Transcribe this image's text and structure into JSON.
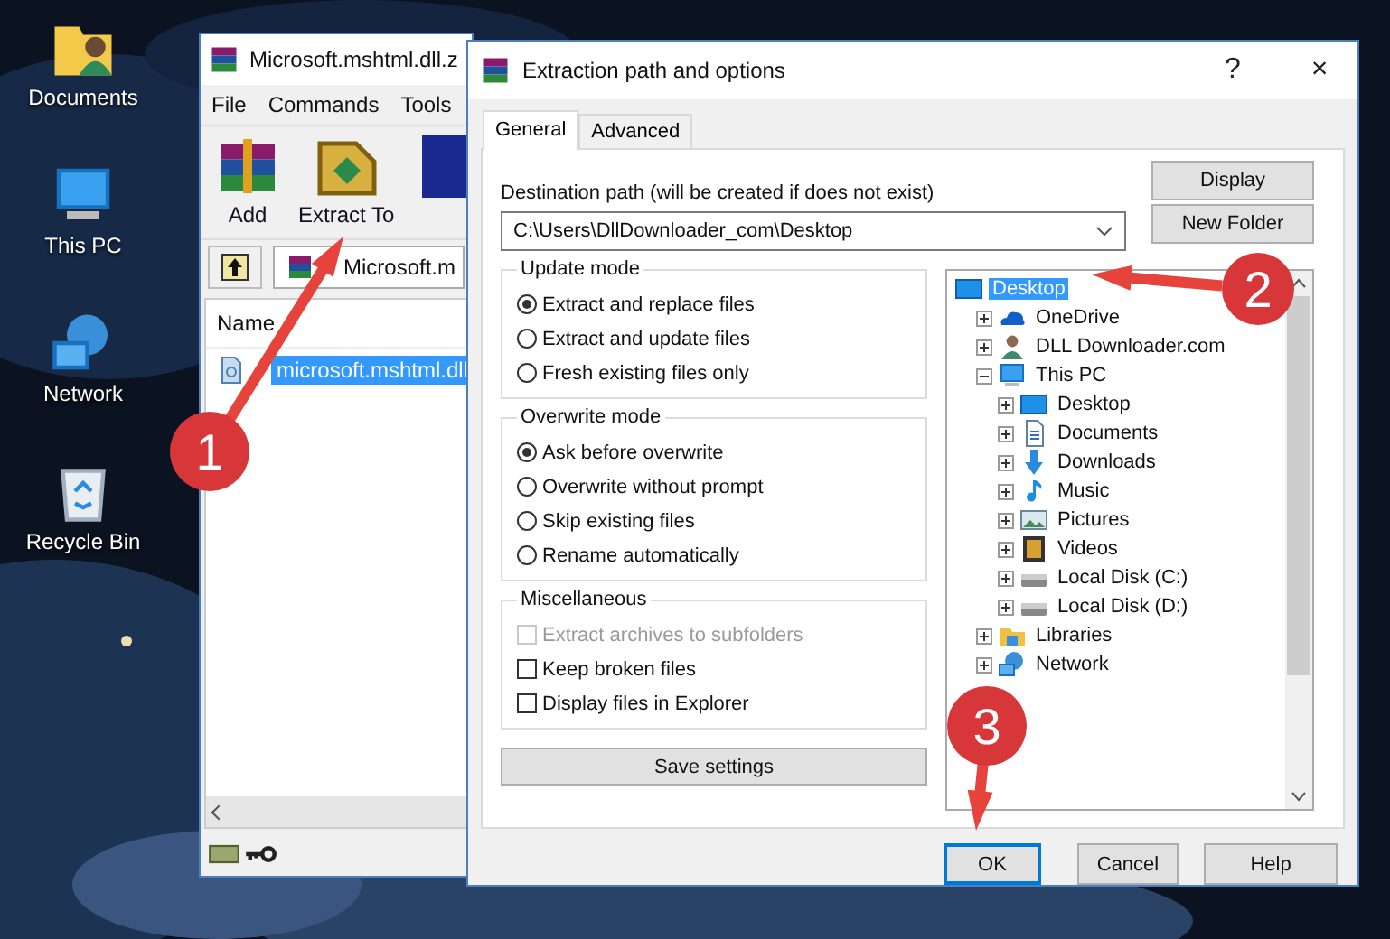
{
  "desktop": {
    "icons": [
      {
        "label": "Documents",
        "kind": "user-folder"
      },
      {
        "label": "This PC",
        "kind": "computer"
      },
      {
        "label": "Network",
        "kind": "network"
      },
      {
        "label": "Recycle Bin",
        "kind": "recycle-bin"
      }
    ]
  },
  "archiver_window": {
    "title": "Microsoft.mshtml.dll.z",
    "menu": [
      "File",
      "Commands",
      "Tools"
    ],
    "toolbar": [
      {
        "label": "Add",
        "kind": "add"
      },
      {
        "label": "Extract To",
        "kind": "extract"
      },
      {
        "kind": "book"
      }
    ],
    "address": "Microsoft.m",
    "columns": [
      "Name"
    ],
    "files": [
      {
        "name": "microsoft.mshtml.dll",
        "selected": true
      }
    ]
  },
  "dialog": {
    "title": "Extraction path and options",
    "help": "?",
    "close": "×",
    "tabs": [
      {
        "label": "General",
        "selected": true
      },
      {
        "label": "Advanced",
        "selected": false
      }
    ],
    "destination_label": "Destination path (will be created if does not exist)",
    "destination_path": "C:\\Users\\DllDownloader_com\\Desktop",
    "side_buttons": [
      "Display",
      "New Folder"
    ],
    "update_mode": {
      "title": "Update mode",
      "options": [
        {
          "label": "Extract and replace files",
          "selected": true
        },
        {
          "label": "Extract and update files",
          "selected": false
        },
        {
          "label": "Fresh existing files only",
          "selected": false
        }
      ]
    },
    "overwrite_mode": {
      "title": "Overwrite mode",
      "options": [
        {
          "label": "Ask before overwrite",
          "selected": true
        },
        {
          "label": "Overwrite without prompt",
          "selected": false
        },
        {
          "label": "Skip existing files",
          "selected": false
        },
        {
          "label": "Rename automatically",
          "selected": false
        }
      ]
    },
    "miscellaneous": {
      "title": "Miscellaneous",
      "options": [
        {
          "label": "Extract archives to subfolders",
          "checked": false,
          "disabled": true
        },
        {
          "label": "Keep broken files",
          "checked": false,
          "disabled": false
        },
        {
          "label": "Display files in Explorer",
          "checked": false,
          "disabled": false
        }
      ]
    },
    "save_button": "Save settings",
    "tree": [
      {
        "label": "Desktop",
        "kind": "desktop",
        "selected": true,
        "children": [
          {
            "label": "OneDrive",
            "kind": "cloud",
            "expanded": false,
            "selected": false
          },
          {
            "label": "DLL Downloader.com",
            "kind": "user",
            "expanded": false,
            "selected": false
          },
          {
            "label": "This PC",
            "kind": "computer",
            "expanded": true,
            "selected": false,
            "children": [
              {
                "label": "Desktop",
                "kind": "desktop",
                "expanded": false,
                "selected": false
              },
              {
                "label": "Documents",
                "kind": "document",
                "expanded": false,
                "selected": false
              },
              {
                "label": "Downloads",
                "kind": "download",
                "expanded": false,
                "selected": false
              },
              {
                "label": "Music",
                "kind": "music",
                "expanded": false,
                "selected": false
              },
              {
                "label": "Pictures",
                "kind": "pictures",
                "expanded": false,
                "selected": false
              },
              {
                "label": "Videos",
                "kind": "videos",
                "expanded": false,
                "selected": false
              },
              {
                "label": "Local Disk (C:)",
                "kind": "disk",
                "expanded": false,
                "selected": false
              },
              {
                "label": "Local Disk (D:)",
                "kind": "disk",
                "expanded": false,
                "selected": false
              }
            ]
          },
          {
            "label": "Libraries",
            "kind": "libraries",
            "expanded": false,
            "selected": false
          },
          {
            "label": "Network",
            "kind": "network",
            "expanded": false,
            "selected": false
          }
        ]
      }
    ],
    "footer_buttons": [
      {
        "label": "OK",
        "default": true
      },
      {
        "label": "Cancel",
        "default": false
      },
      {
        "label": "Help",
        "default": false
      }
    ]
  },
  "callouts": [
    {
      "number": "1"
    },
    {
      "number": "2"
    },
    {
      "number": "3"
    }
  ]
}
